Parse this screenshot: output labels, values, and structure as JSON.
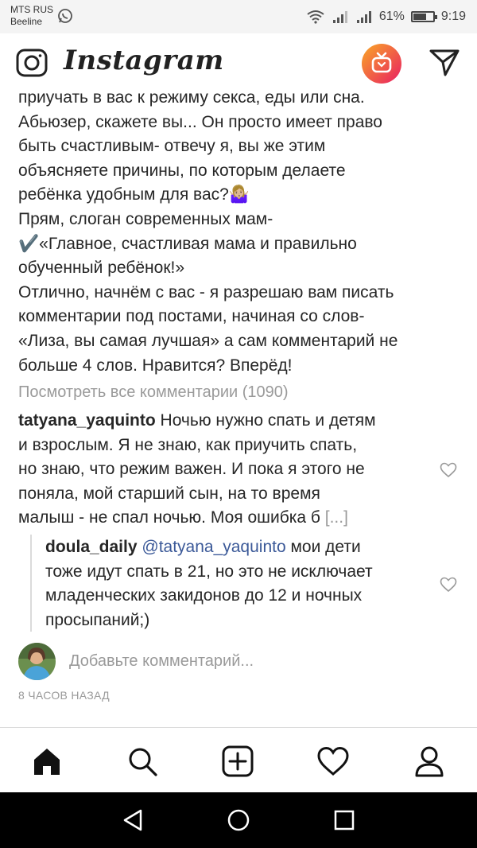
{
  "status_bar": {
    "carrier_line1": "MTS RUS",
    "carrier_line2": "Beeline",
    "battery_percent": "61%",
    "battery_level": 0.61,
    "time": "9:19",
    "icons": [
      "whatsapp-icon",
      "wifi-icon",
      "signal-icon",
      "signal-icon",
      "battery-icon"
    ]
  },
  "header": {
    "app_name": "Instagram",
    "icons": [
      "camera-icon",
      "igtv-icon",
      "direct-message-icon"
    ]
  },
  "post": {
    "caption_lines": [
      "приучать в вас к режиму секса, еды или сна.",
      "Абьюзер, скажете вы... Он просто имеет право",
      "быть счастливым- отвечу я, вы же этим",
      "объясняете причины, по которым делаете",
      "ребёнка удобным для вас?🤷🏼‍♀️",
      "Прям, слоган современных мам-",
      "✔️«Главное, счастливая мама и правильно",
      "обученный ребёнок!»",
      "Отлично, начнём с вас - я разрешаю вам писать",
      "комментарии под постами, начиная со слов-",
      "«Лиза, вы самая лучшая» а сам комментарий не",
      "больше 4 слов. Нравится? Вперёд!"
    ],
    "view_all_comments": "Посмотреть все комментарии (1090)",
    "comments": [
      {
        "username": "tatyana_yaquinto",
        "text_lines": [
          " Ночью нужно спать и детям",
          "и взрослым. Я не знаю, как приучить спать,",
          "но знаю, что режим важен. И пока я этого не",
          "поняла, мой старший сын, на то время",
          "малыш - не спал ночью. Моя ошибка б "
        ],
        "more": "[...]"
      }
    ],
    "reply": {
      "username": "doula_daily",
      "mention": "@tatyana_yaquinto",
      "text_first": " мои дети",
      "text_lines": [
        "тоже идут спать в 21, но это не исключает",
        "младенческих закидонов до 12 и ночных",
        "просыпаний;)"
      ]
    },
    "add_comment_placeholder": "Добавьте комментарий...",
    "timestamp": "8 ЧАСОВ НАЗАД"
  },
  "bottom_nav": {
    "items": [
      "home-icon",
      "search-icon",
      "new-post-icon",
      "activity-heart-icon",
      "profile-icon"
    ]
  },
  "system_nav": {
    "items": [
      "back-icon",
      "home-circle-icon",
      "recents-icon"
    ]
  },
  "colors": {
    "text": "#262626",
    "muted": "#9a9a9a",
    "mention": "#3b5998",
    "igtv_gradient_start": "#f9a825",
    "igtv_gradient_end": "#e91e63"
  }
}
